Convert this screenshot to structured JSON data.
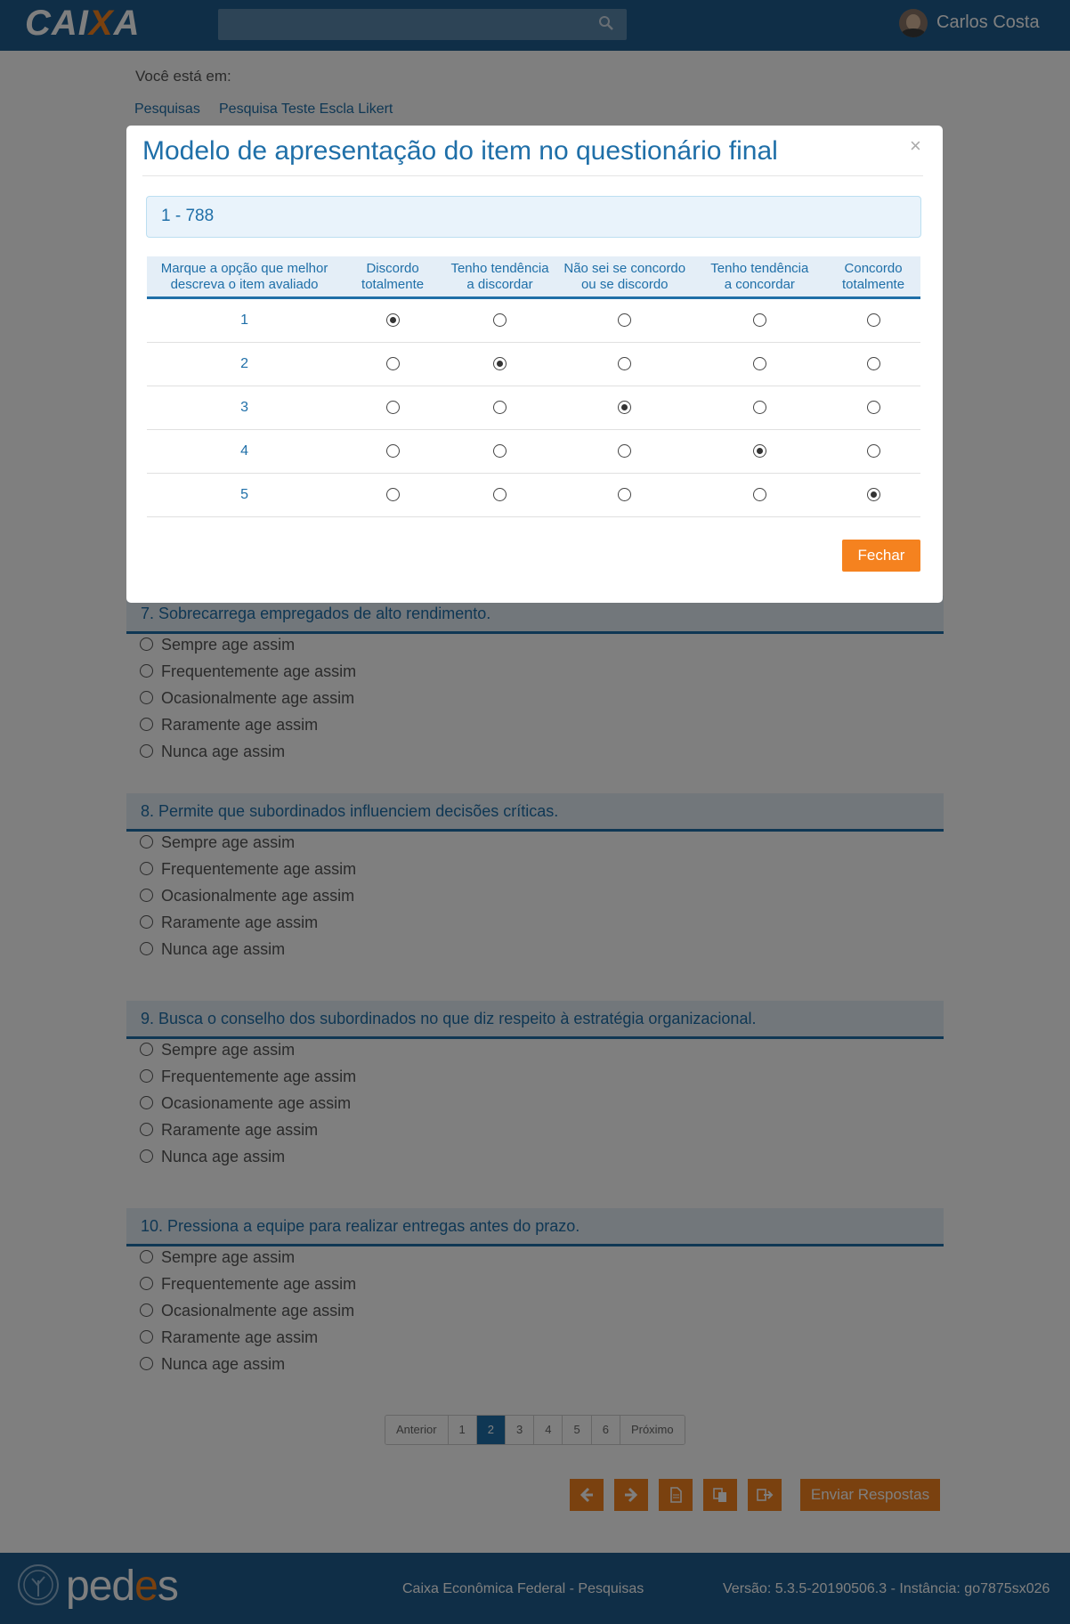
{
  "header": {
    "logo": "CAIXA",
    "user_name": "Carlos Costa"
  },
  "breadcrumb": {
    "label": "Você está em:",
    "items": [
      "Pesquisas",
      "Pesquisa Teste Escla Likert"
    ]
  },
  "questions": [
    {
      "title": "7. Sobrecarrega empregados de alto rendimento.",
      "options": [
        "Sempre age assim",
        "Frequentemente age assim",
        "Ocasionalmente age assim",
        "Raramente age assim",
        "Nunca age assim"
      ]
    },
    {
      "title": "8. Permite que subordinados influenciem decisões críticas.",
      "options": [
        "Sempre age assim",
        "Frequentemente age assim",
        "Ocasionalmente age assim",
        "Raramente age assim",
        "Nunca age assim"
      ]
    },
    {
      "title": "9. Busca o conselho dos subordinados no que diz respeito à estratégia organizacional.",
      "options": [
        "Sempre age assim",
        "Frequentemente age assim",
        "Ocasionamente age assim",
        "Raramente age assim",
        "Nunca age assim"
      ]
    },
    {
      "title": "10. Pressiona a equipe para realizar entregas antes do prazo.",
      "options": [
        "Sempre age assim",
        "Frequentemente age assim",
        "Ocasionalmente age assim",
        "Raramente age assim",
        "Nunca age assim"
      ]
    }
  ],
  "pagination": {
    "prev": "Anterior",
    "pages": [
      "1",
      "2",
      "3",
      "4",
      "5",
      "6"
    ],
    "active": "2",
    "next": "Próximo"
  },
  "toolbar": {
    "icons": [
      "arrow-left-icon",
      "arrow-right-icon",
      "document-icon",
      "copy-icon",
      "exit-icon"
    ],
    "send_label": "Enviar Respostas"
  },
  "footer": {
    "brand": "pedes",
    "center": "Caixa Econômica Federal - Pesquisas",
    "right": "Versão: 5.3.5-20190506.3 - Instância: go7875sx026"
  },
  "modal": {
    "title": "Modelo de apresentação do item no questionário final",
    "close": "×",
    "item_label": "1 - 788",
    "header_first": [
      "Marque a opção que melhor",
      "descreva o item avaliado"
    ],
    "columns": [
      [
        "Discordo",
        "totalmente"
      ],
      [
        "Tenho tendência",
        "a discordar"
      ],
      [
        "Não sei se concordo",
        "ou se discordo"
      ],
      [
        "Tenho tendência",
        "a concordar"
      ],
      [
        "Concordo",
        "totalmente"
      ]
    ],
    "rows": [
      {
        "label": "1",
        "selected": 0
      },
      {
        "label": "2",
        "selected": 1
      },
      {
        "label": "3",
        "selected": 2
      },
      {
        "label": "4",
        "selected": 3
      },
      {
        "label": "5",
        "selected": 4
      }
    ],
    "button": "Fechar"
  },
  "colors": {
    "primary": "#1f6fa8",
    "header": "#1f5d8e",
    "accent": "#f5821f"
  }
}
